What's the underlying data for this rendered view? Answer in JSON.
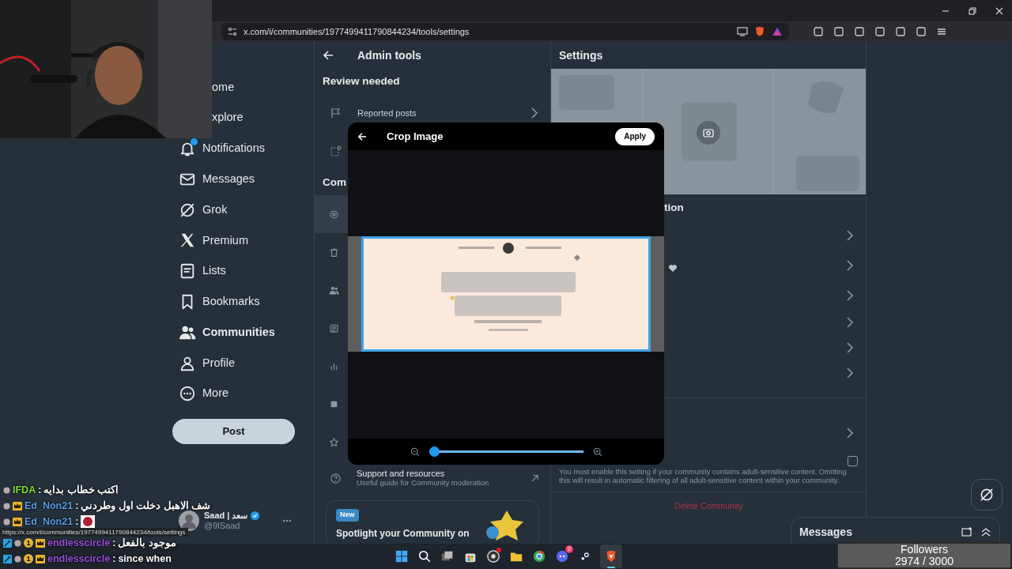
{
  "browser": {
    "url": "x.com/i/communities/1977499411790844234/tools/settings",
    "status_url": "https://x.com/i/communities/1977499411790844234/tools/settings"
  },
  "nav": {
    "items": [
      {
        "label": "ome",
        "selected": false,
        "badge": false
      },
      {
        "label": "xplore",
        "selected": false,
        "badge": false
      },
      {
        "label": "Notifications",
        "selected": false,
        "badge": true
      },
      {
        "label": "Messages",
        "selected": false,
        "badge": false
      },
      {
        "label": "Grok",
        "selected": false,
        "badge": false
      },
      {
        "label": "Premium",
        "selected": false,
        "badge": false
      },
      {
        "label": "Lists",
        "selected": false,
        "badge": false
      },
      {
        "label": "Bookmarks",
        "selected": false,
        "badge": false
      },
      {
        "label": "Communities",
        "selected": true,
        "badge": false
      },
      {
        "label": "Profile",
        "selected": false,
        "badge": false
      },
      {
        "label": "More",
        "selected": false,
        "badge": false
      }
    ],
    "post_button": "Post",
    "account": {
      "name": "Saad | سعد",
      "handle": "@9lSaad",
      "verified": true
    }
  },
  "admin": {
    "title": "Admin tools",
    "review_heading": "Review needed",
    "reported_posts": "Reported posts",
    "community_heading": "Com",
    "rows": [
      {
        "selected": true
      },
      {
        "selected": false
      },
      {
        "selected": false
      },
      {
        "selected": false
      },
      {
        "selected": false
      },
      {
        "selected": false
      },
      {
        "selected": false
      }
    ],
    "support": {
      "title": "Support and resources",
      "subtitle": "Useful guide for Community moderation"
    },
    "spotlight": {
      "badge": "New",
      "title": "Spotlight your Community on"
    }
  },
  "settings": {
    "title": "Settings",
    "section_heading": "tion",
    "adult_description": "You must enable this setting if your community contains adult-sensitive content. Omitting this will result in automatic filtering of all adult-sensitive content within your community.",
    "adult_checked": false,
    "delete": "Delete Community"
  },
  "messages_drawer": {
    "title": "Messages"
  },
  "modal": {
    "title": "Crop Image",
    "apply": "Apply",
    "zoom": {
      "level": 0
    }
  },
  "chat": [
    {
      "user": "IFDA",
      "color": "#7ee03a",
      "separator": ":",
      "badges": [
        {
          "kind": "sub"
        }
      ],
      "message": {
        "kind": "text",
        "text": "اكتب خطاب بدايه"
      }
    },
    {
      "user": "Ed_Non21",
      "color": "#5b9de3",
      "separator": ":",
      "badges": [
        {
          "kind": "sub"
        },
        {
          "kind": "crown"
        }
      ],
      "message": {
        "kind": "text",
        "text": "شف الاهبل دخلت اول وطردني"
      }
    },
    {
      "user": "Ed_Non21",
      "color": "#5b9de3",
      "separator": ":",
      "badges": [
        {
          "kind": "sub"
        },
        {
          "kind": "crown"
        }
      ],
      "message": {
        "kind": "emote"
      }
    },
    {
      "user": "endlesscircle",
      "color": "#9b4fd8",
      "separator": ":",
      "badges": [
        {
          "kind": "mod"
        },
        {
          "kind": "sub"
        },
        {
          "kind": "gift",
          "text": "1"
        },
        {
          "kind": "crown"
        }
      ],
      "message": {
        "kind": "text",
        "text": "موجود بالفعل"
      }
    },
    {
      "user": "endlesscircle",
      "color": "#9b4fd8",
      "separator": ":",
      "badges": [
        {
          "kind": "mod"
        },
        {
          "kind": "sub"
        },
        {
          "kind": "gift",
          "text": "1"
        },
        {
          "kind": "crown"
        }
      ],
      "message": {
        "kind": "text",
        "text": "since when"
      }
    }
  ],
  "taskbar": [
    {
      "active": false
    },
    {
      "active": false
    },
    {
      "active": false
    },
    {
      "active": false
    },
    {
      "active": false,
      "dot": true
    },
    {
      "active": false
    },
    {
      "active": false
    },
    {
      "active": false,
      "count": "2"
    },
    {
      "active": false
    },
    {
      "active": true
    }
  ],
  "followers": {
    "label": "Followers",
    "count": "2974 / 3000"
  }
}
